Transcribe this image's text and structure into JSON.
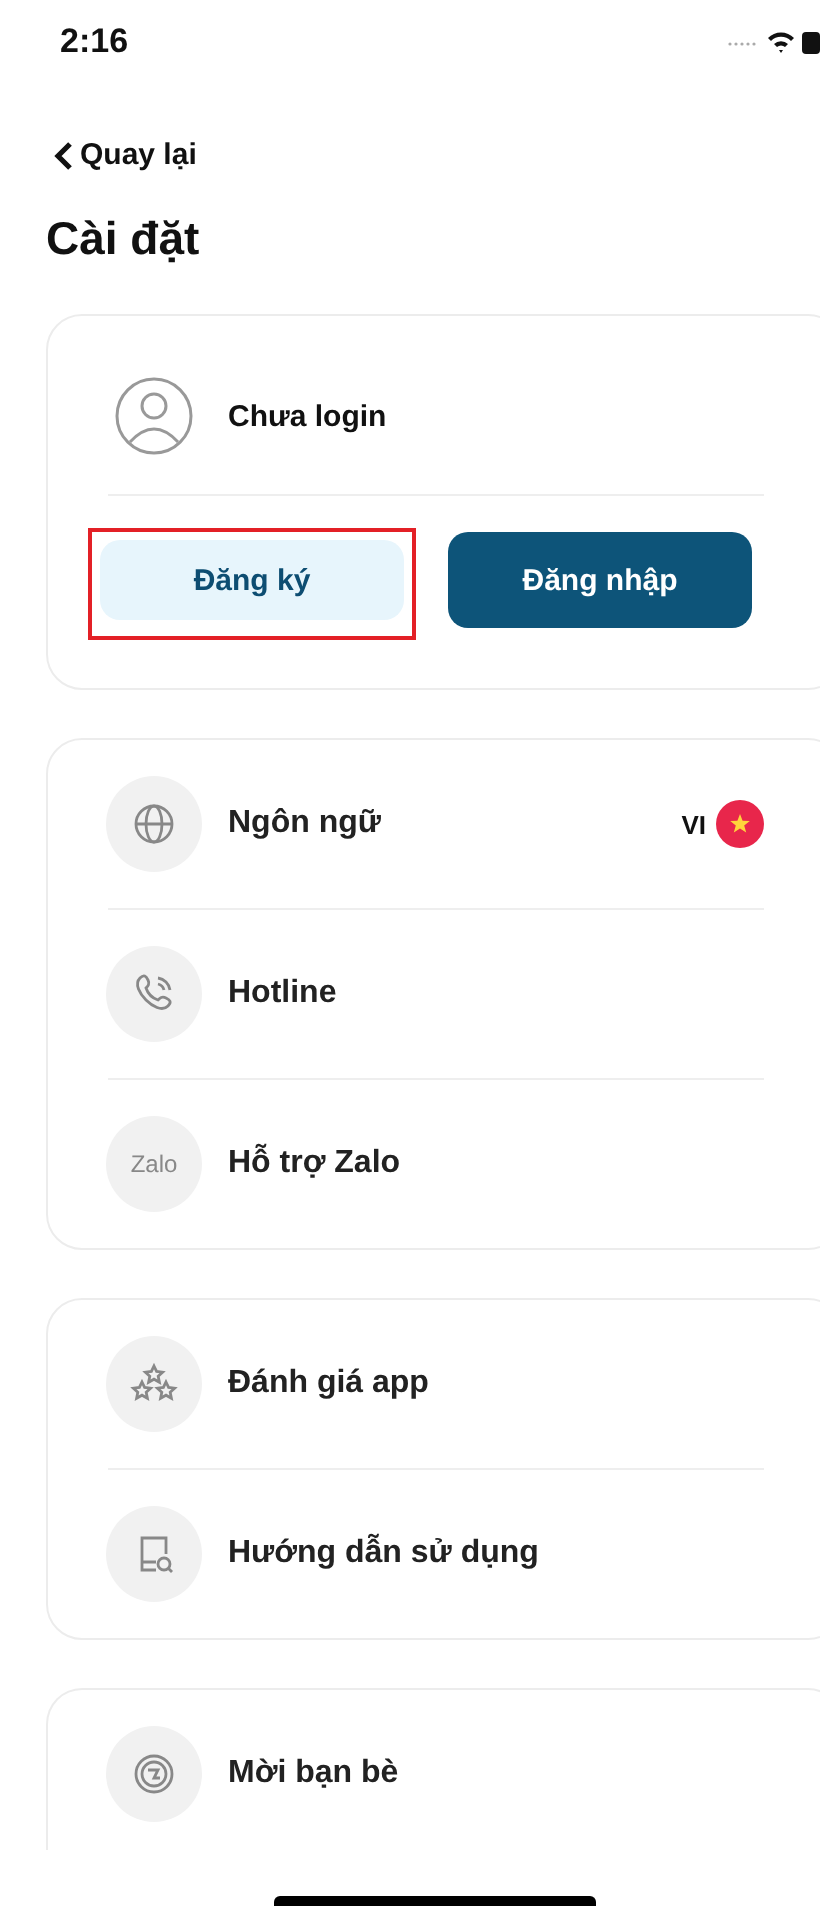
{
  "status_bar": {
    "time": "2:16"
  },
  "back": {
    "label": "Quay lại"
  },
  "title": "Cài đặt",
  "account": {
    "name": "Chưa login",
    "buttons": [
      {
        "label": "Đăng ký",
        "kind": "secondary",
        "highlighted": true
      },
      {
        "label": "Đăng nhập",
        "kind": "primary",
        "highlighted": false
      }
    ]
  },
  "groups": [
    {
      "items": [
        {
          "label": "Ngôn ngữ",
          "kind": "globe",
          "value": "VI"
        },
        {
          "label": "Hotline",
          "kind": "phone"
        },
        {
          "label": "Hỗ trợ Zalo",
          "kind": "text",
          "icon_text": "Zalo"
        }
      ]
    },
    {
      "items": [
        {
          "label": "Đánh giá app",
          "kind": "stars"
        },
        {
          "label": "Hướng dẫn sử dụng",
          "kind": "guide"
        }
      ]
    },
    {
      "items": [
        {
          "label": "Mời bạn bè",
          "kind": "share"
        }
      ]
    }
  ]
}
